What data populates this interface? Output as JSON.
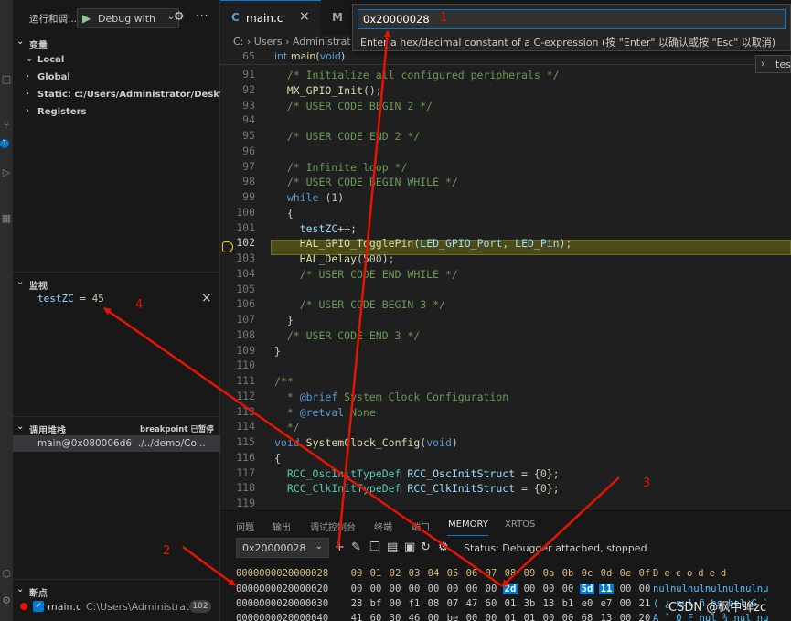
{
  "sidebar": {
    "title": "运行和调...",
    "config": "Debug with",
    "variables": {
      "header": "变量",
      "items": [
        {
          "label": "Local",
          "expanded": true
        },
        {
          "label": "Global",
          "expanded": false
        },
        {
          "label": "Static: c:/Users/Administrator/Desktop/dem",
          "expanded": false
        },
        {
          "label": "Registers",
          "expanded": false
        }
      ]
    },
    "watch": {
      "header": "监视",
      "expr": "testZC",
      "sep": " = ",
      "value": "45"
    },
    "callstack": {
      "header": "调用堆栈",
      "paused": "breakpoint 已暂停",
      "frame": "main@0x080006d6",
      "frame_path": "./../demo/Co..."
    },
    "breakpoints": {
      "header": "断点",
      "file": "main.c",
      "path": "C:\\Users\\Administrat...",
      "line": "102"
    }
  },
  "activity": {
    "badge": "1"
  },
  "tabs": [
    {
      "name": "main.c",
      "icon": "C"
    },
    {
      "name": "M"
    }
  ],
  "breadcrumb": "C: › Users › Administrat",
  "quick_input": {
    "value": "0x20000028",
    "message": "Enter a hex/decimal constant of a C-expression (按 \"Enter\" 以确认或按 \"Esc\" 以取消)"
  },
  "outline_hint": {
    "text": "test"
  },
  "editor": {
    "sticky": {
      "line": "65",
      "text": "int main(void)"
    },
    "lines": [
      {
        "n": "91",
        "t": "  /* Initialize all configured peripherals */"
      },
      {
        "n": "92",
        "t": "  MX_GPIO_Init();"
      },
      {
        "n": "93",
        "t": "  /* USER CODE BEGIN 2 */"
      },
      {
        "n": "94",
        "t": ""
      },
      {
        "n": "95",
        "t": "  /* USER CODE END 2 */"
      },
      {
        "n": "96",
        "t": ""
      },
      {
        "n": "97",
        "t": "  /* Infinite loop */"
      },
      {
        "n": "98",
        "t": "  /* USER CODE BEGIN WHILE */"
      },
      {
        "n": "99",
        "t": "  while (1)"
      },
      {
        "n": "100",
        "t": "  {"
      },
      {
        "n": "101",
        "t": "    testZC++;"
      },
      {
        "n": "102",
        "t": "    HAL_GPIO_TogglePin(LED_GPIO_Port, LED_Pin);"
      },
      {
        "n": "103",
        "t": "    HAL_Delay(500);"
      },
      {
        "n": "104",
        "t": "    /* USER CODE END WHILE */"
      },
      {
        "n": "105",
        "t": ""
      },
      {
        "n": "106",
        "t": "    /* USER CODE BEGIN 3 */"
      },
      {
        "n": "107",
        "t": "  }"
      },
      {
        "n": "108",
        "t": "  /* USER CODE END 3 */"
      },
      {
        "n": "109",
        "t": "}"
      },
      {
        "n": "110",
        "t": ""
      },
      {
        "n": "111",
        "t": "/**"
      },
      {
        "n": "112",
        "t": "  * @brief System Clock Configuration"
      },
      {
        "n": "113",
        "t": "  * @retval None"
      },
      {
        "n": "114",
        "t": "  */"
      },
      {
        "n": "115",
        "t": "void SystemClock_Config(void)"
      },
      {
        "n": "116",
        "t": "{"
      },
      {
        "n": "117",
        "t": "  RCC_OscInitTypeDef RCC_OscInitStruct = {0};"
      },
      {
        "n": "118",
        "t": "  RCC_ClkInitTypeDef RCC_ClkInitStruct = {0};"
      },
      {
        "n": "119",
        "t": ""
      }
    ],
    "current_line": "102"
  },
  "panel": {
    "tabs": [
      "问题",
      "输出",
      "调试控制台",
      "终端",
      "端口",
      "MEMORY",
      "XRTOS"
    ],
    "active_tab": "MEMORY",
    "address": "0x20000028",
    "status": "Status: Debugger attached, stopped",
    "header": {
      "addr": "0000000020000028",
      "cols": [
        "00",
        "01",
        "02",
        "03",
        "04",
        "05",
        "06",
        "07",
        "08",
        "09",
        "0a",
        "0b",
        "0c",
        "0d",
        "0e",
        "0f"
      ],
      "decoded": "Decoded"
    },
    "rows": [
      {
        "addr": "0000000020000020",
        "bytes": [
          "00",
          "00",
          "00",
          "00",
          "00",
          "00",
          "00",
          "00",
          "2d",
          "00",
          "00",
          "00",
          "5d",
          "11",
          "00",
          "00"
        ],
        "decoded": "nulnulnulnulnulnulnu"
      },
      {
        "addr": "0000000020000030",
        "bytes": [
          "28",
          "bf",
          "00",
          "f1",
          "08",
          "07",
          "47",
          "60",
          "01",
          "3b",
          "13",
          "b1",
          "e0",
          "e7",
          "00",
          "21"
        ],
        "decoded": "( ¿ nul ñ bs bel G `"
      },
      {
        "addr": "0000000020000040",
        "bytes": [
          "41",
          "60",
          "30",
          "46",
          "00",
          "be",
          "00",
          "00",
          "01",
          "01",
          "00",
          "00",
          "68",
          "13",
          "00",
          "20"
        ],
        "decoded": "A ` 0 F nul ¾ nul nu"
      }
    ]
  },
  "watermark": "CSDN @枫中眸zc",
  "annotations": [
    "1",
    "2",
    "3",
    "4"
  ],
  "colors": {
    "accent": "#0078d4",
    "annotation": "#e51400",
    "breakpoint": "#e51400"
  }
}
